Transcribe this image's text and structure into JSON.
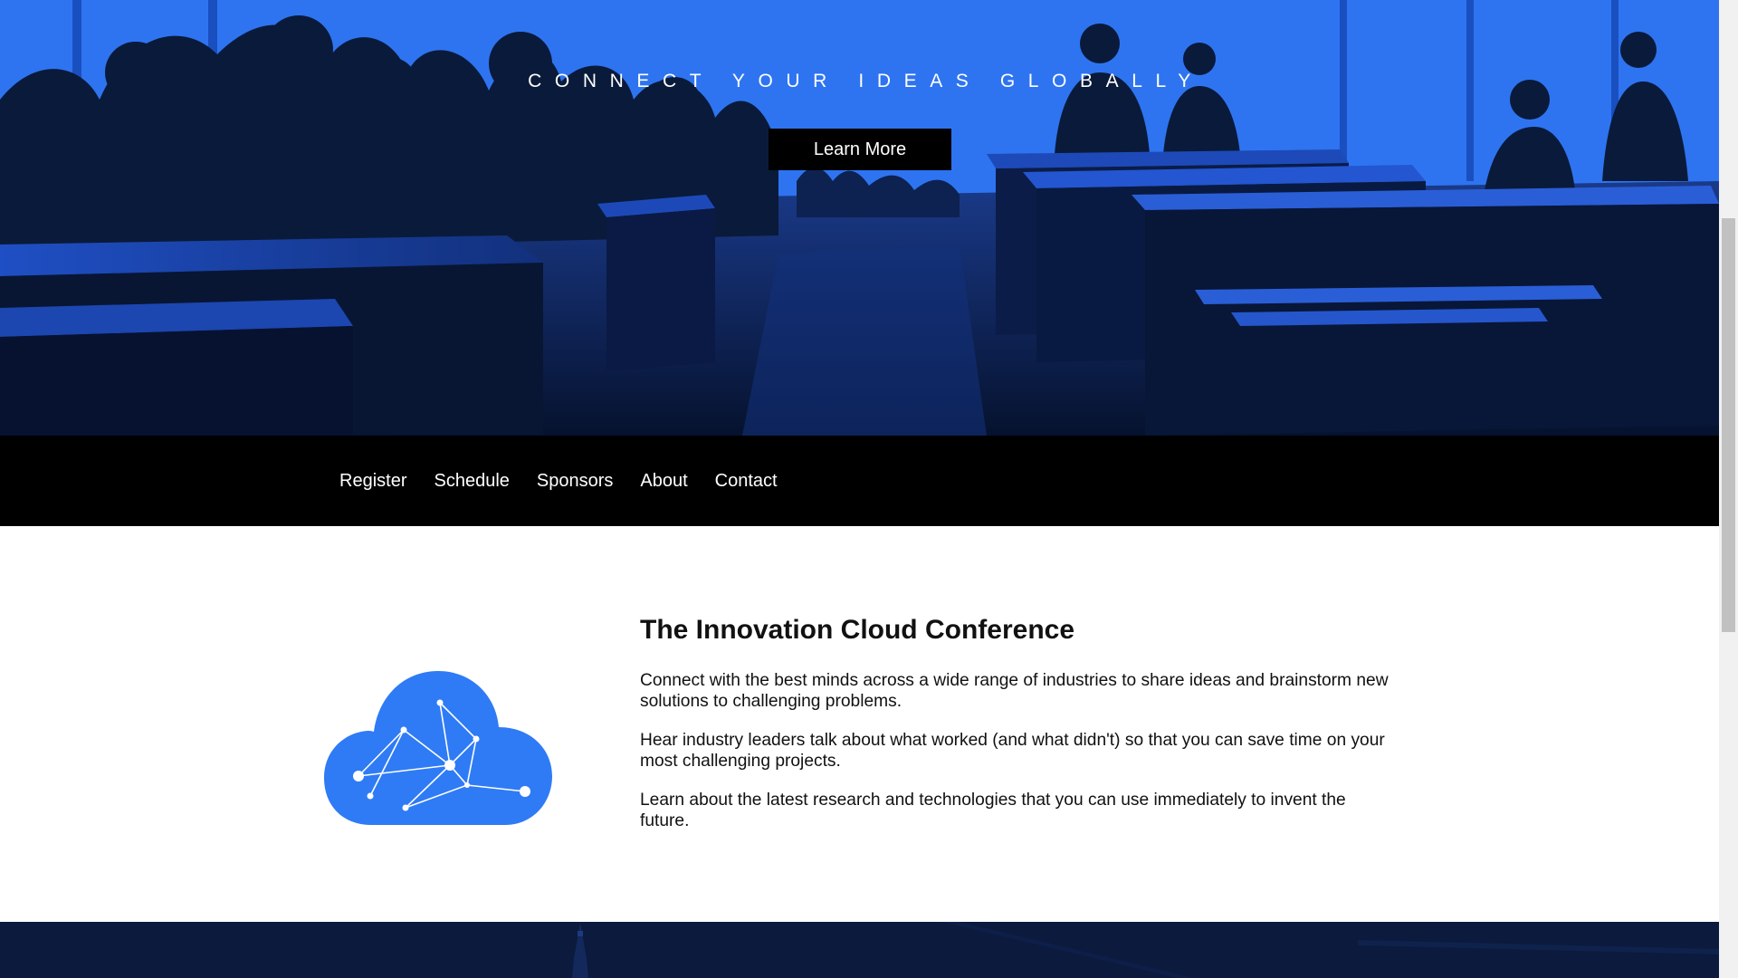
{
  "hero": {
    "tagline": "CONNECT YOUR IDEAS GLOBALLY",
    "cta_label": "Learn More",
    "image_icon": "conference-hall-silhouette-icon"
  },
  "nav": {
    "items": [
      {
        "label": "Register"
      },
      {
        "label": "Schedule"
      },
      {
        "label": "Sponsors"
      },
      {
        "label": "About"
      },
      {
        "label": "Contact"
      }
    ]
  },
  "about": {
    "logo_icon": "network-cloud-icon",
    "title": "The Innovation Cloud Conference",
    "paragraphs": [
      "Connect with the best minds across a wide range of industries to share ideas and brainstorm new solutions to challenging problems.",
      "Hear industry leaders talk about what worked (and what didn't) so that you can save time on your most challenging projects.",
      "Learn about the latest research and technologies that you can use immediately to invent the future."
    ]
  },
  "colors": {
    "hero_blue": "#2e74f1",
    "silhouette": "#0a1a3a",
    "nav_bg": "#000000",
    "cloud_blue": "#2f7bf5",
    "footer_bg": "#0b1a3d"
  }
}
